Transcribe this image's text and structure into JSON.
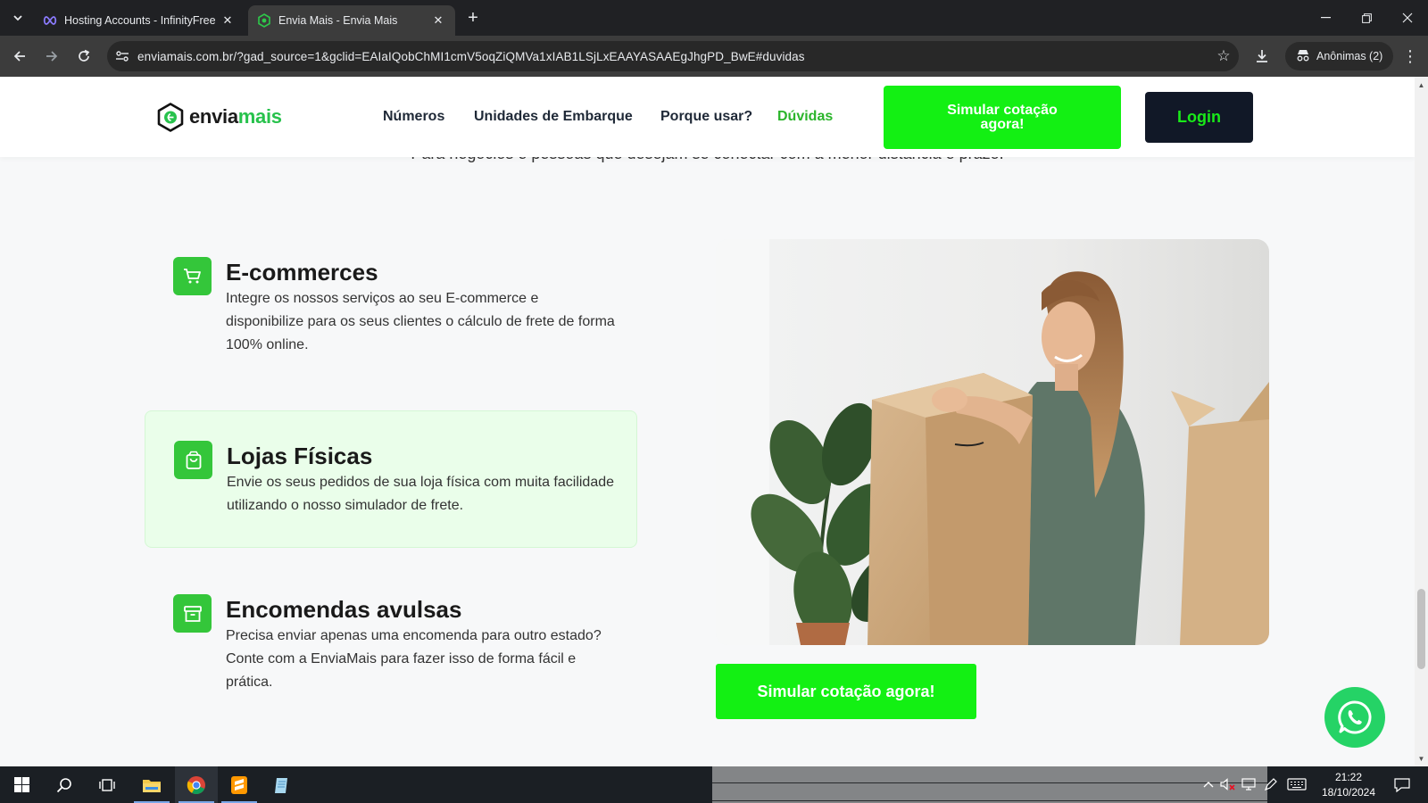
{
  "browser": {
    "tabs": [
      {
        "title": "Hosting Accounts - InfinityFree",
        "icon": "infinity-icon"
      },
      {
        "title": "Envia Mais - Envia Mais",
        "icon": "enviamais-favicon"
      }
    ],
    "url": "enviamais.com.br/?gad_source=1&gclid=EAIaIQobChMI1cmV5oqZiQMVa1xIAB1LSjLxEAAYASAAEgJhgPD_BwE#duvidas",
    "incognito_label": "Anônimas (2)"
  },
  "site": {
    "logo": {
      "part1": "envia",
      "part2": "mais"
    },
    "nav": [
      "Números",
      "Unidades de Embarque",
      "Porque usar?",
      "Dúvidas"
    ],
    "nav_active": "Dúvidas",
    "cta_top": "Simular cotação agora!",
    "login": "Login",
    "subtitle": "Para negócios e pessoas que desejam se conectar com a menor distância e prazo.",
    "features": [
      {
        "icon": "shopping-cart-icon",
        "title": "E-commerces",
        "description": "Integre os nossos serviços ao seu E-commerce e disponibilize para os seus clientes o cálculo de frete de forma 100% online."
      },
      {
        "icon": "shopping-bag-icon",
        "title": "Lojas Físicas",
        "description": "Envie os seus pedidos de sua loja física com muita facilidade utilizando o nosso simulador de frete."
      },
      {
        "icon": "archive-box-icon",
        "title": "Encomendas avulsas",
        "description": "Precisa enviar apenas uma encomenda para outro estado? Conte com a EnviaMais para fazer isso de forma fácil e prática."
      }
    ],
    "cta_bottom": "Simular cotação agora!",
    "colors": {
      "brand_green": "#13f013",
      "icon_green": "#34c63a",
      "dark": "#111827",
      "highlight_bg": "#eafeea"
    }
  },
  "taskbar": {
    "time": "21:22",
    "date": "18/10/2024"
  }
}
